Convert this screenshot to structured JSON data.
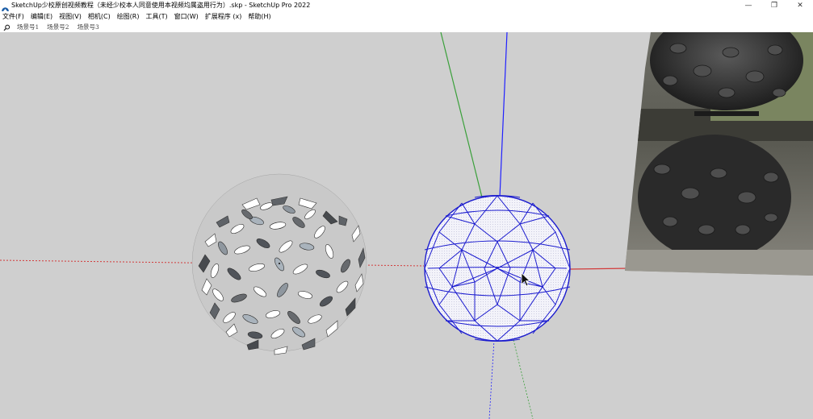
{
  "window": {
    "title": "SketchUp少校原创视频教程（未经少校本人同意使用本视频均属盗用行为）.skp - SketchUp Pro 2022",
    "minimize_glyph": "—",
    "maximize_glyph": "❐",
    "close_glyph": "✕"
  },
  "menu": {
    "items": [
      {
        "label": "文件(F)"
      },
      {
        "label": "编辑(E)"
      },
      {
        "label": "视图(V)"
      },
      {
        "label": "相机(C)"
      },
      {
        "label": "绘图(R)"
      },
      {
        "label": "工具(T)"
      },
      {
        "label": "窗口(W)"
      },
      {
        "label": "扩展程序 (x)"
      },
      {
        "label": "帮助(H)"
      }
    ]
  },
  "scenes": {
    "tabs": [
      {
        "label": "场景号1"
      },
      {
        "label": "场景号2"
      },
      {
        "label": "场景号3"
      }
    ]
  },
  "icons": {
    "app": "sketchup-logo-icon",
    "search": "search-icon",
    "cursor": "mouse-cursor-icon"
  },
  "colors": {
    "viewport_bg": "#cfcfcf",
    "red_axis": "#d23a3a",
    "green_axis": "#3aa03a",
    "blue_axis": "#2020ff",
    "sphere_edge": "#1c1ccf",
    "sphere_face": "#f4f4fb"
  }
}
